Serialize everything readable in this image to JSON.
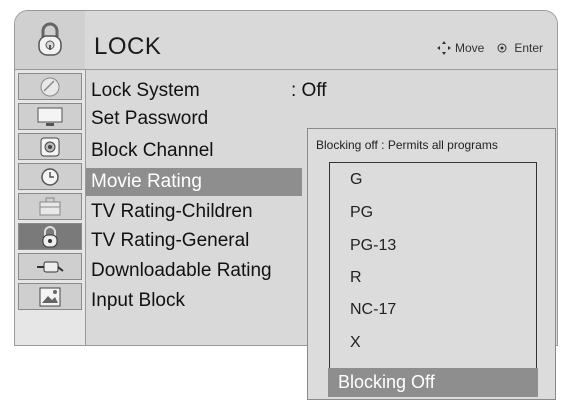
{
  "header": {
    "title": "LOCK",
    "hint_move": "Move",
    "hint_enter": "Enter"
  },
  "sidebar": {
    "items": [
      {
        "icon": "satellite-dish-icon"
      },
      {
        "icon": "monitor-icon"
      },
      {
        "icon": "speaker-icon"
      },
      {
        "icon": "clock-icon"
      },
      {
        "icon": "briefcase-icon"
      },
      {
        "icon": "lock-icon",
        "active": true
      },
      {
        "icon": "cable-plug-icon"
      },
      {
        "icon": "picture-icon"
      }
    ]
  },
  "menu": {
    "items": [
      {
        "label": "Lock System",
        "value": ": Off"
      },
      {
        "label": "Set Password"
      },
      {
        "label": "Block Channel"
      },
      {
        "label": "Movie Rating",
        "selected": true
      },
      {
        "label": "TV Rating-Children"
      },
      {
        "label": "TV Rating-General"
      },
      {
        "label": "Downloadable Rating"
      },
      {
        "label": "Input Block"
      }
    ]
  },
  "popup": {
    "hint": "Blocking off : Permits all programs",
    "options": [
      "G",
      "PG",
      "PG-13",
      "R",
      "NC-17",
      "X"
    ],
    "blocking_label": "Blocking Off"
  },
  "colors": {
    "panel_bg": "#d9d9d9",
    "selected_bg": "#8e8e8e",
    "selected_text": "#ffffff"
  }
}
